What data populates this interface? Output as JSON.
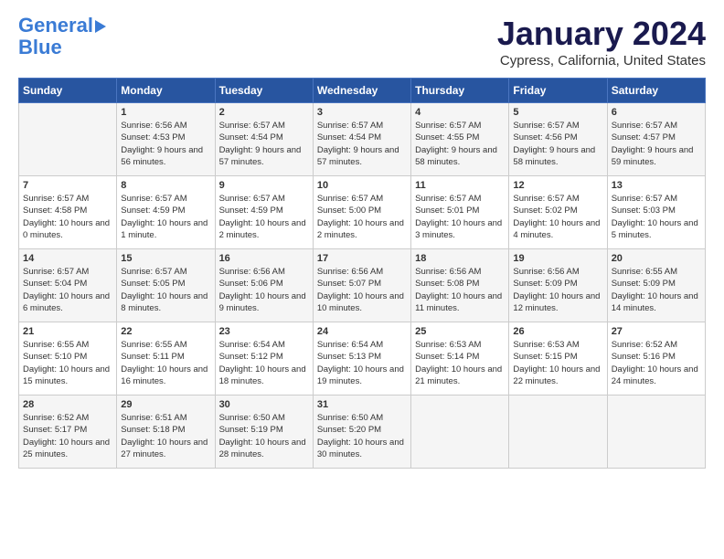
{
  "logo": {
    "line1": "General",
    "line2": "Blue"
  },
  "title": "January 2024",
  "location": "Cypress, California, United States",
  "weekdays": [
    "Sunday",
    "Monday",
    "Tuesday",
    "Wednesday",
    "Thursday",
    "Friday",
    "Saturday"
  ],
  "weeks": [
    [
      {
        "day": "",
        "sunrise": "",
        "sunset": "",
        "daylight": ""
      },
      {
        "day": "1",
        "sunrise": "Sunrise: 6:56 AM",
        "sunset": "Sunset: 4:53 PM",
        "daylight": "Daylight: 9 hours and 56 minutes."
      },
      {
        "day": "2",
        "sunrise": "Sunrise: 6:57 AM",
        "sunset": "Sunset: 4:54 PM",
        "daylight": "Daylight: 9 hours and 57 minutes."
      },
      {
        "day": "3",
        "sunrise": "Sunrise: 6:57 AM",
        "sunset": "Sunset: 4:54 PM",
        "daylight": "Daylight: 9 hours and 57 minutes."
      },
      {
        "day": "4",
        "sunrise": "Sunrise: 6:57 AM",
        "sunset": "Sunset: 4:55 PM",
        "daylight": "Daylight: 9 hours and 58 minutes."
      },
      {
        "day": "5",
        "sunrise": "Sunrise: 6:57 AM",
        "sunset": "Sunset: 4:56 PM",
        "daylight": "Daylight: 9 hours and 58 minutes."
      },
      {
        "day": "6",
        "sunrise": "Sunrise: 6:57 AM",
        "sunset": "Sunset: 4:57 PM",
        "daylight": "Daylight: 9 hours and 59 minutes."
      }
    ],
    [
      {
        "day": "7",
        "sunrise": "Sunrise: 6:57 AM",
        "sunset": "Sunset: 4:58 PM",
        "daylight": "Daylight: 10 hours and 0 minutes."
      },
      {
        "day": "8",
        "sunrise": "Sunrise: 6:57 AM",
        "sunset": "Sunset: 4:59 PM",
        "daylight": "Daylight: 10 hours and 1 minute."
      },
      {
        "day": "9",
        "sunrise": "Sunrise: 6:57 AM",
        "sunset": "Sunset: 4:59 PM",
        "daylight": "Daylight: 10 hours and 2 minutes."
      },
      {
        "day": "10",
        "sunrise": "Sunrise: 6:57 AM",
        "sunset": "Sunset: 5:00 PM",
        "daylight": "Daylight: 10 hours and 2 minutes."
      },
      {
        "day": "11",
        "sunrise": "Sunrise: 6:57 AM",
        "sunset": "Sunset: 5:01 PM",
        "daylight": "Daylight: 10 hours and 3 minutes."
      },
      {
        "day": "12",
        "sunrise": "Sunrise: 6:57 AM",
        "sunset": "Sunset: 5:02 PM",
        "daylight": "Daylight: 10 hours and 4 minutes."
      },
      {
        "day": "13",
        "sunrise": "Sunrise: 6:57 AM",
        "sunset": "Sunset: 5:03 PM",
        "daylight": "Daylight: 10 hours and 5 minutes."
      }
    ],
    [
      {
        "day": "14",
        "sunrise": "Sunrise: 6:57 AM",
        "sunset": "Sunset: 5:04 PM",
        "daylight": "Daylight: 10 hours and 6 minutes."
      },
      {
        "day": "15",
        "sunrise": "Sunrise: 6:57 AM",
        "sunset": "Sunset: 5:05 PM",
        "daylight": "Daylight: 10 hours and 8 minutes."
      },
      {
        "day": "16",
        "sunrise": "Sunrise: 6:56 AM",
        "sunset": "Sunset: 5:06 PM",
        "daylight": "Daylight: 10 hours and 9 minutes."
      },
      {
        "day": "17",
        "sunrise": "Sunrise: 6:56 AM",
        "sunset": "Sunset: 5:07 PM",
        "daylight": "Daylight: 10 hours and 10 minutes."
      },
      {
        "day": "18",
        "sunrise": "Sunrise: 6:56 AM",
        "sunset": "Sunset: 5:08 PM",
        "daylight": "Daylight: 10 hours and 11 minutes."
      },
      {
        "day": "19",
        "sunrise": "Sunrise: 6:56 AM",
        "sunset": "Sunset: 5:09 PM",
        "daylight": "Daylight: 10 hours and 12 minutes."
      },
      {
        "day": "20",
        "sunrise": "Sunrise: 6:55 AM",
        "sunset": "Sunset: 5:09 PM",
        "daylight": "Daylight: 10 hours and 14 minutes."
      }
    ],
    [
      {
        "day": "21",
        "sunrise": "Sunrise: 6:55 AM",
        "sunset": "Sunset: 5:10 PM",
        "daylight": "Daylight: 10 hours and 15 minutes."
      },
      {
        "day": "22",
        "sunrise": "Sunrise: 6:55 AM",
        "sunset": "Sunset: 5:11 PM",
        "daylight": "Daylight: 10 hours and 16 minutes."
      },
      {
        "day": "23",
        "sunrise": "Sunrise: 6:54 AM",
        "sunset": "Sunset: 5:12 PM",
        "daylight": "Daylight: 10 hours and 18 minutes."
      },
      {
        "day": "24",
        "sunrise": "Sunrise: 6:54 AM",
        "sunset": "Sunset: 5:13 PM",
        "daylight": "Daylight: 10 hours and 19 minutes."
      },
      {
        "day": "25",
        "sunrise": "Sunrise: 6:53 AM",
        "sunset": "Sunset: 5:14 PM",
        "daylight": "Daylight: 10 hours and 21 minutes."
      },
      {
        "day": "26",
        "sunrise": "Sunrise: 6:53 AM",
        "sunset": "Sunset: 5:15 PM",
        "daylight": "Daylight: 10 hours and 22 minutes."
      },
      {
        "day": "27",
        "sunrise": "Sunrise: 6:52 AM",
        "sunset": "Sunset: 5:16 PM",
        "daylight": "Daylight: 10 hours and 24 minutes."
      }
    ],
    [
      {
        "day": "28",
        "sunrise": "Sunrise: 6:52 AM",
        "sunset": "Sunset: 5:17 PM",
        "daylight": "Daylight: 10 hours and 25 minutes."
      },
      {
        "day": "29",
        "sunrise": "Sunrise: 6:51 AM",
        "sunset": "Sunset: 5:18 PM",
        "daylight": "Daylight: 10 hours and 27 minutes."
      },
      {
        "day": "30",
        "sunrise": "Sunrise: 6:50 AM",
        "sunset": "Sunset: 5:19 PM",
        "daylight": "Daylight: 10 hours and 28 minutes."
      },
      {
        "day": "31",
        "sunrise": "Sunrise: 6:50 AM",
        "sunset": "Sunset: 5:20 PM",
        "daylight": "Daylight: 10 hours and 30 minutes."
      },
      {
        "day": "",
        "sunrise": "",
        "sunset": "",
        "daylight": ""
      },
      {
        "day": "",
        "sunrise": "",
        "sunset": "",
        "daylight": ""
      },
      {
        "day": "",
        "sunrise": "",
        "sunset": "",
        "daylight": ""
      }
    ]
  ]
}
